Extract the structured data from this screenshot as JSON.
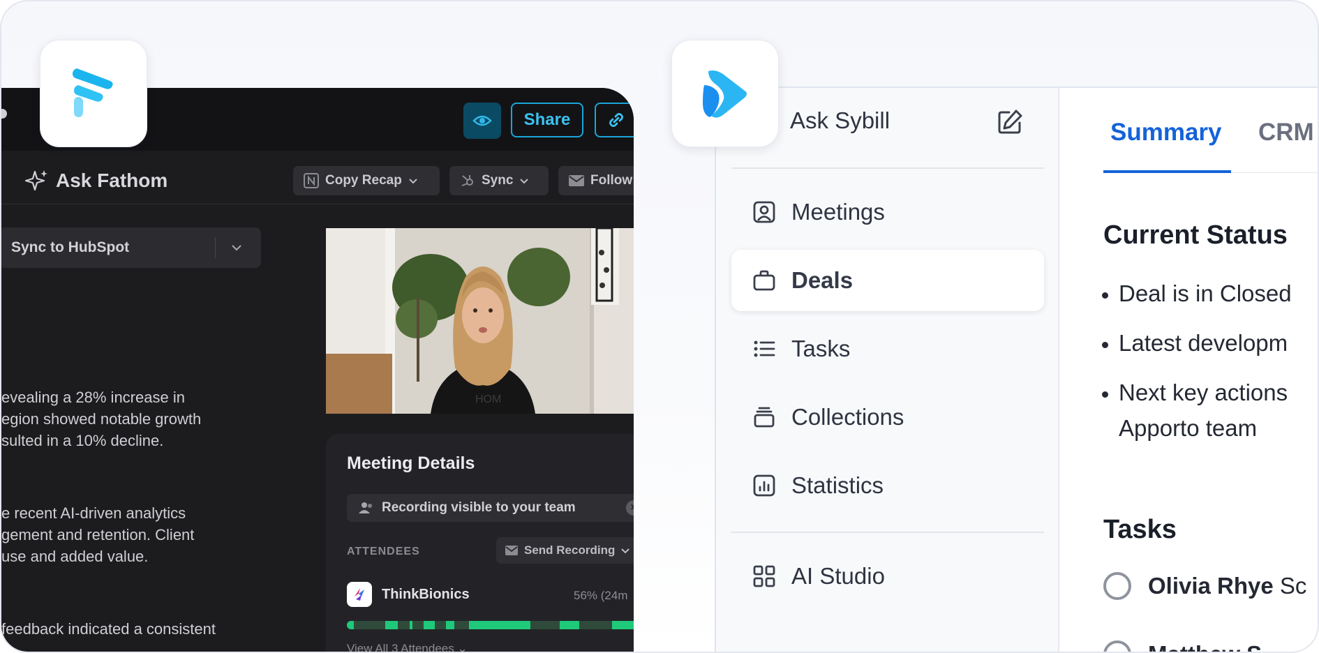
{
  "fathom": {
    "share_label": "Share",
    "ask_label": "Ask Fathom",
    "copy_recap_label": "Copy Recap",
    "sync_label": "Sync",
    "follow_label": "Follow",
    "sync_hubspot_label": "Sync to HubSpot",
    "summary_lines": [
      "evealing a 28% increase in",
      "egion showed notable growth",
      "sulted in a 10% decline.",
      "e recent AI-driven analytics",
      "gement and retention. Client",
      "use and added value.",
      "feedback indicated a consistent"
    ],
    "meeting_details": {
      "title": "Meeting Details",
      "recording_visibility": "Recording visible to your team",
      "attendees_label": "ATTENDEES",
      "send_recording_label": "Send Recording",
      "attendee_name": "ThinkBionics",
      "attendee_share": "56% (24m",
      "talk_time_fraction": 0.56,
      "view_all_label": "View All 3 Attendees"
    }
  },
  "sybill": {
    "ask_label": "Ask Sybill",
    "nav": {
      "meetings": "Meetings",
      "deals": "Deals",
      "tasks": "Tasks",
      "collections": "Collections",
      "statistics": "Statistics",
      "ai_studio": "AI Studio"
    },
    "tabs": {
      "summary": "Summary",
      "crm": "CRM"
    },
    "current_status_heading": "Current Status",
    "bullets": [
      "Deal is in Closed",
      "Latest developm",
      "Next key actions",
      "Apporto team"
    ],
    "tasks_heading": "Tasks",
    "task_1_name": "Olivia Rhye",
    "task_1_suffix": "Sc",
    "task_2_name": "Matthew S"
  },
  "colors": {
    "fathom_accent": "#19a6d9",
    "fathom_bg": "#1c1c1f",
    "talk_time_green": "#1fc97a",
    "sybill_accent": "#1463d9"
  }
}
